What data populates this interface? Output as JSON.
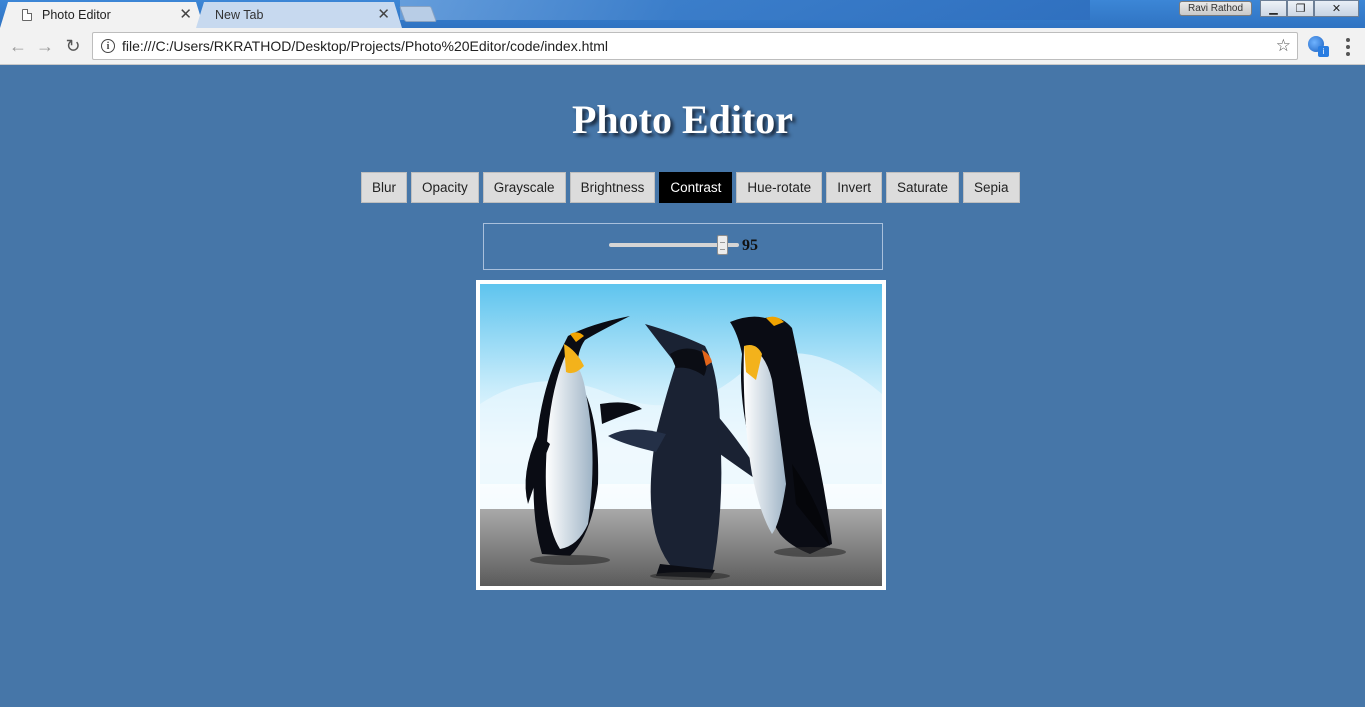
{
  "browser": {
    "tabs": [
      {
        "title": "Photo Editor",
        "active": true
      },
      {
        "title": "New Tab",
        "active": false
      }
    ],
    "profile_name": "Ravi Rathod",
    "url": "file:///C:/Users/RKRATHOD/Desktop/Projects/Photo%20Editor/code/index.html",
    "extension_badge": "i",
    "icons": [
      "back-arrow-icon",
      "forward-arrow-icon",
      "reload-icon",
      "info-icon",
      "star-icon",
      "menu-icon",
      "close-icon"
    ]
  },
  "page": {
    "title": "Photo Editor",
    "filters": [
      {
        "label": "Blur",
        "active": false
      },
      {
        "label": "Opacity",
        "active": false
      },
      {
        "label": "Grayscale",
        "active": false
      },
      {
        "label": "Brightness",
        "active": false
      },
      {
        "label": "Contrast",
        "active": true
      },
      {
        "label": "Hue-rotate",
        "active": false
      },
      {
        "label": "Invert",
        "active": false
      },
      {
        "label": "Saturate",
        "active": false
      },
      {
        "label": "Sepia",
        "active": false
      }
    ],
    "slider": {
      "value": "95",
      "fraction": 0.91
    }
  },
  "colors": {
    "page_background": "#4676a8",
    "active_filter": "#000000",
    "inactive_filter": "#dcdcdc"
  }
}
